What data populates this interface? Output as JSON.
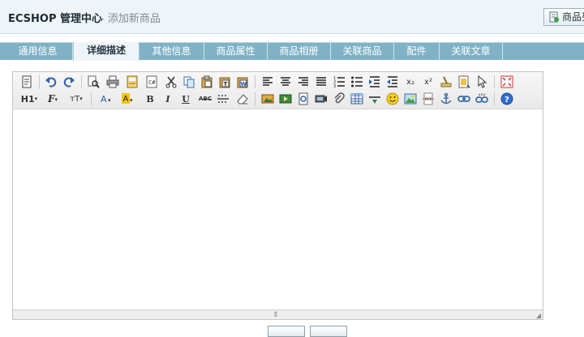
{
  "header": {
    "brand": "ECSHOP 管理中心",
    "subtitle": "- 添加新商品",
    "action_label": "商品列表"
  },
  "tabs": [
    {
      "label": "通用信息"
    },
    {
      "label": "详细描述"
    },
    {
      "label": "其他信息"
    },
    {
      "label": "商品属性"
    },
    {
      "label": "商品相册"
    },
    {
      "label": "关联商品"
    },
    {
      "label": "配件"
    },
    {
      "label": "关联文章"
    }
  ],
  "toolbar": {
    "h1": "H1",
    "font": "F",
    "size": "тT",
    "bold": "B",
    "italic": "I",
    "underline": "U",
    "strike": "ABC",
    "superscript": "x²",
    "subscript": "x₂"
  },
  "footer": {
    "submit_label": "",
    "reset_label": ""
  }
}
